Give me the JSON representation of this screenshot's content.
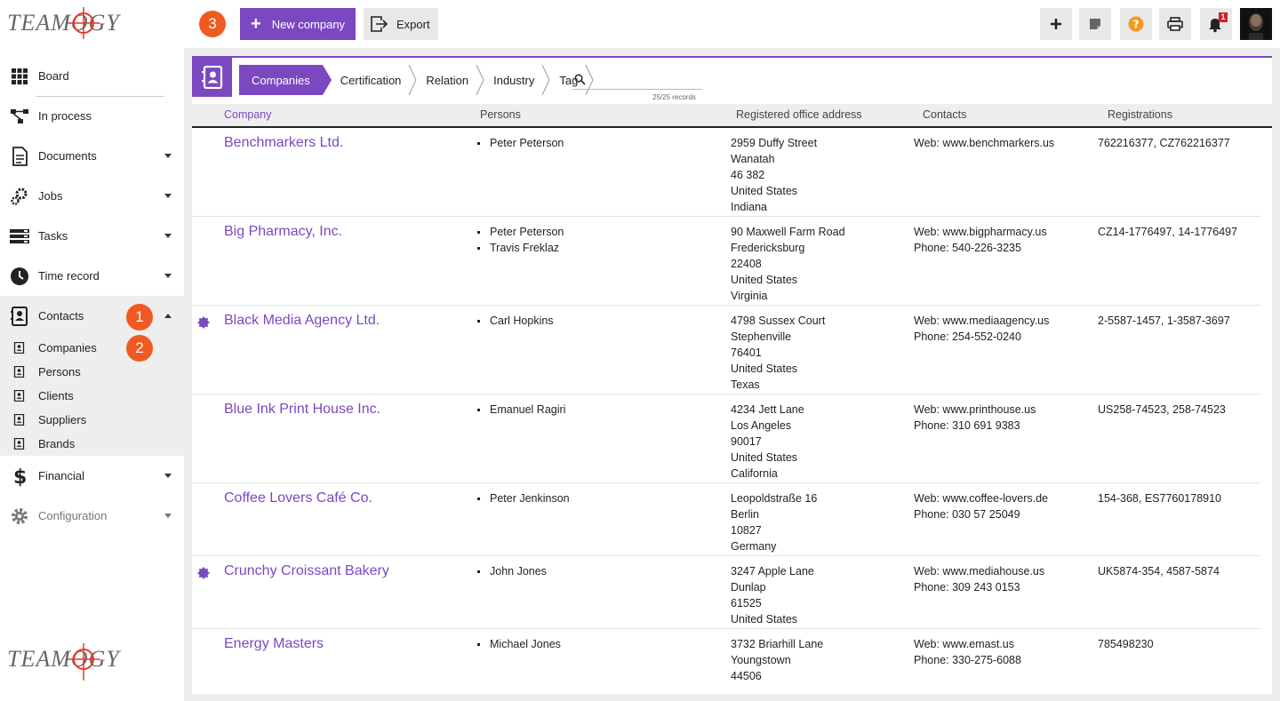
{
  "brand": "TEAMOGY",
  "sidebar": {
    "items": [
      {
        "label": "Board",
        "icon": "grid-icon"
      },
      {
        "label": "In process",
        "icon": "workflow-icon"
      },
      {
        "label": "Documents",
        "icon": "document-icon"
      },
      {
        "label": "Jobs",
        "icon": "gears-icon"
      },
      {
        "label": "Tasks",
        "icon": "tasks-icon"
      },
      {
        "label": "Time record",
        "icon": "clock-icon"
      },
      {
        "label": "Contacts",
        "icon": "contact-book-icon"
      },
      {
        "label": "Financial",
        "icon": "dollar-icon"
      },
      {
        "label": "Configuration",
        "icon": "gear-icon"
      }
    ],
    "subitems": [
      {
        "label": "Companies"
      },
      {
        "label": "Persons"
      },
      {
        "label": "Clients"
      },
      {
        "label": "Suppliers"
      },
      {
        "label": "Brands"
      }
    ]
  },
  "badges": {
    "one": "1",
    "two": "2",
    "three": "3"
  },
  "toolbar": {
    "new_label": "New company",
    "export_label": "Export",
    "notification_count": "1"
  },
  "tabs": [
    "Companies",
    "Certification",
    "Relation",
    "Industry",
    "Tag"
  ],
  "search": {
    "placeholder": "",
    "records": "25/25 records"
  },
  "columns": {
    "company": "Company",
    "persons": "Persons",
    "address": "Registered office address",
    "contacts": "Contacts",
    "registrations": "Registrations"
  },
  "rows": [
    {
      "name": "Benchmarkers Ltd.",
      "starred": false,
      "persons": [
        "Peter Peterson"
      ],
      "address": [
        "2959 Duffy Street",
        "Wanatah",
        "46 382",
        "United States",
        "Indiana"
      ],
      "contacts": [
        "Web: www.benchmarkers.us"
      ],
      "registrations": "762216377, CZ762216377"
    },
    {
      "name": "Big Pharmacy, Inc.",
      "starred": false,
      "persons": [
        "Peter Peterson",
        "Travis Freklaz"
      ],
      "address": [
        "90 Maxwell Farm Road",
        "Fredericksburg",
        "22408",
        "United States",
        "Virginia"
      ],
      "contacts": [
        "Web: www.bigpharmacy.us",
        "Phone: 540-226-3235"
      ],
      "registrations": "CZ14-1776497, 14-1776497"
    },
    {
      "name": "Black Media Agency Ltd.",
      "starred": true,
      "persons": [
        "Carl Hopkins"
      ],
      "address": [
        "4798 Sussex Court",
        "Stephenville",
        "76401",
        "United States",
        "Texas"
      ],
      "contacts": [
        "Web: www.mediaagency.us",
        "Phone: 254-552-0240"
      ],
      "registrations": "2-5587-1457, 1-3587-3697"
    },
    {
      "name": "Blue Ink Print House Inc.",
      "starred": false,
      "persons": [
        "Emanuel Ragiri"
      ],
      "address": [
        "4234 Jett Lane",
        "Los Angeles",
        "90017",
        "United States",
        "California"
      ],
      "contacts": [
        "Web: www.printhouse.us",
        "Phone: 310 691 9383"
      ],
      "registrations": "US258-74523, 258-74523"
    },
    {
      "name": "Coffee Lovers Café Co.",
      "starred": false,
      "persons": [
        "Peter Jenkinson"
      ],
      "address": [
        "Leopoldstraße 16",
        "Berlin",
        "10827",
        "Germany"
      ],
      "contacts": [
        "Web: www.coffee-lovers.de",
        "Phone: 030 57 25049"
      ],
      "registrations": "154-368, ES7760178910"
    },
    {
      "name": "Crunchy Croissant Bakery",
      "starred": true,
      "persons": [
        "John Jones"
      ],
      "address": [
        "3247 Apple Lane",
        "Dunlap",
        "61525",
        "United States"
      ],
      "contacts": [
        "Web: www.mediahouse.us",
        "Phone: 309 243 0153"
      ],
      "registrations": "UK5874-354, 4587-5874"
    },
    {
      "name": "Energy Masters",
      "starred": false,
      "persons": [
        "Michael Jones"
      ],
      "address": [
        "3732 Briarhill Lane",
        "Youngstown",
        "44506"
      ],
      "contacts": [
        "Web: www.emast.us",
        "Phone: 330-275-6088"
      ],
      "registrations": "785498230"
    }
  ],
  "colors": {
    "accent": "#7b48c2",
    "badge": "#f05a22",
    "help": "#f39a1e",
    "notif": "#d32020"
  }
}
